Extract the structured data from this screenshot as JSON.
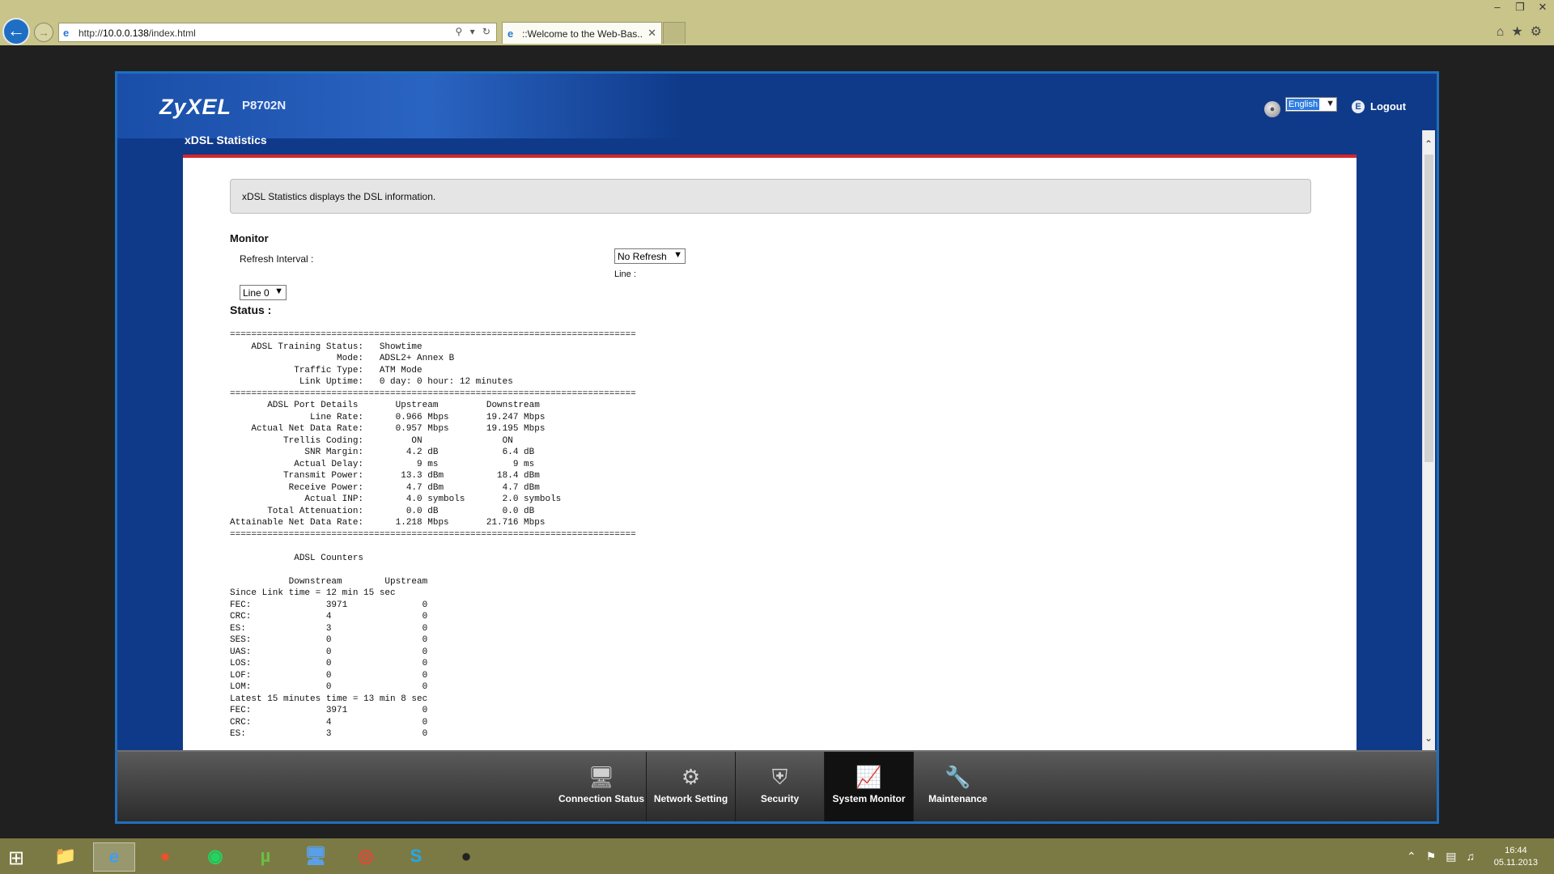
{
  "browser": {
    "url_prefix": "http://",
    "url_host": "10.0.0.138",
    "url_path": "/index.html",
    "tab_title": "::Welcome to the Web-Bas...",
    "window_controls": [
      "–",
      "❐",
      "✕"
    ]
  },
  "router": {
    "brand": "ZyXEL",
    "model": "P8702N",
    "page_title": "xDSL Statistics",
    "language_value": "English",
    "logout_label": "Logout"
  },
  "main": {
    "info_text": "xDSL Statistics displays the DSL information.",
    "monitor_title": "Monitor",
    "refresh_label": "Refresh Interval :",
    "refresh_value": "No Refresh",
    "line_label": "Line :",
    "line_value": "Line 0",
    "status_title": "Status :",
    "status_text": "============================================================================\n    ADSL Training Status:   Showtime\n                    Mode:   ADSL2+ Annex B\n            Traffic Type:   ATM Mode\n             Link Uptime:   0 day: 0 hour: 12 minutes\n============================================================================\n       ADSL Port Details       Upstream         Downstream\n               Line Rate:      0.966 Mbps       19.247 Mbps\n    Actual Net Data Rate:      0.957 Mbps       19.195 Mbps\n          Trellis Coding:         ON               ON\n              SNR Margin:        4.2 dB            6.4 dB\n            Actual Delay:          9 ms              9 ms\n          Transmit Power:       13.3 dBm          18.4 dBm\n           Receive Power:        4.7 dBm           4.7 dBm\n              Actual INP:        4.0 symbols       2.0 symbols\n       Total Attenuation:        0.0 dB            0.0 dB\nAttainable Net Data Rate:      1.218 Mbps       21.716 Mbps\n============================================================================\n\n            ADSL Counters\n\n           Downstream        Upstream\nSince Link time = 12 min 15 sec\nFEC:              3971              0\nCRC:              4                 0\nES:               3                 0\nSES:              0                 0\nUAS:              0                 0\nLOS:              0                 0\nLOF:              0                 0\nLOM:              0                 0\nLatest 15 minutes time = 13 min 8 sec\nFEC:              3971              0\nCRC:              4                 0\nES:               3                 0"
  },
  "nav": {
    "items": [
      {
        "label": "Connection Status",
        "icon": "monitor-icon"
      },
      {
        "label": "Network Setting",
        "icon": "gear-icon"
      },
      {
        "label": "Security",
        "icon": "shield-icon"
      },
      {
        "label": "System Monitor",
        "icon": "chart-icon"
      },
      {
        "label": "Maintenance",
        "icon": "tools-icon"
      }
    ],
    "active": "System Monitor"
  },
  "taskbar": {
    "time": "16:44",
    "date": "05.11.2013"
  },
  "colors": {
    "router_blue": "#0f3a8a",
    "frame_border": "#1f6fbf",
    "accent_red": "#d8242c",
    "taskbar": "#7b7a44",
    "ie_chrome": "#c8c48a"
  }
}
